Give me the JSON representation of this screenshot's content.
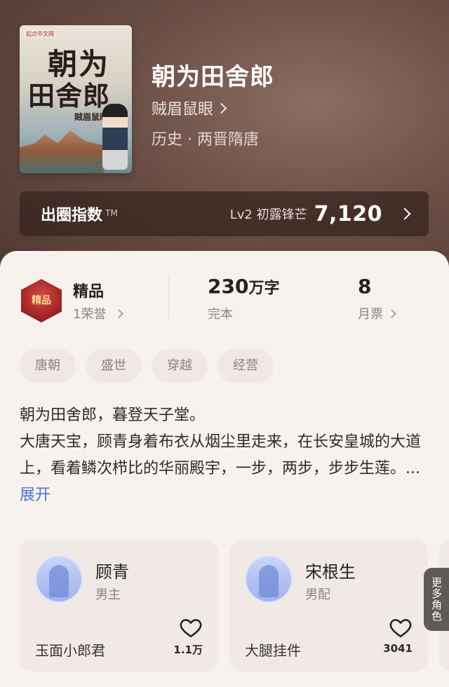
{
  "book": {
    "title": "朝为田舍郎",
    "author": "贼眉鼠眼",
    "genre": "历史 · 两晋隋唐"
  },
  "cover": {
    "publisher": "起点中文网",
    "title_line1": "朝为",
    "title_line2": "田舍郎",
    "author": "贼眉鼠眼"
  },
  "index_bar": {
    "label": "出圈指数",
    "tm": "TM",
    "level": "Lv2 初露锋芒",
    "score": "7,120"
  },
  "stats": {
    "badge_icon_text": "精品",
    "quality_label": "精品",
    "honor": "1荣誉",
    "word_count": "230",
    "word_unit": "万字",
    "status": "完本",
    "monthly_votes": "8",
    "votes_label": "月票"
  },
  "tags": [
    "唐朝",
    "盛世",
    "穿越",
    "经营"
  ],
  "description": {
    "line1": "朝为田舍郎，暮登天子堂。",
    "line2": "大唐天宝，顾青身着布衣从烟尘里走来，在长安皇城的大道上，看着鳞次栉比的华丽殿宇，一步，两步，步步生莲。",
    "ellipsis": "...",
    "expand": "展开"
  },
  "roles": [
    {
      "name": "顾青",
      "type": "男主",
      "title": "玉面小郎君",
      "likes": "1.1万"
    },
    {
      "name": "宋根生",
      "type": "男配",
      "title": "大腿挂件",
      "likes": "3041"
    }
  ],
  "more_roles": "更多角色",
  "colors": {
    "accent_link": "#4d74c7",
    "sheet_bg": "#f8f2ee",
    "hero_bg": "#6a4e45"
  }
}
